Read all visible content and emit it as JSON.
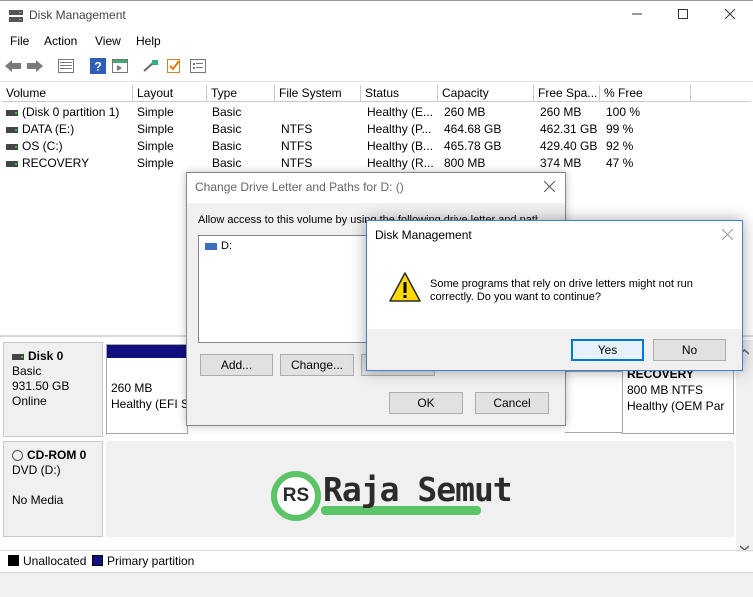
{
  "window": {
    "title": "Disk Management"
  },
  "icons": {
    "app": "disk-management-icon",
    "minimize": "minimize-icon",
    "maximize": "maximize-icon",
    "close": "close-icon",
    "warning": "warning-icon"
  },
  "menu": [
    "File",
    "Action",
    "View",
    "Help"
  ],
  "toolbar": [
    "back-icon",
    "forward-icon",
    "details-view-icon",
    "help-icon",
    "console-view-icon",
    "connect-icon",
    "checklist-icon",
    "properties-icon"
  ],
  "volume_table": {
    "columns": [
      "Volume",
      "Layout",
      "Type",
      "File System",
      "Status",
      "Capacity",
      "Free Spa...",
      "% Free"
    ],
    "rows": [
      [
        "(Disk 0 partition 1)",
        "Simple",
        "Basic",
        "",
        "Healthy (E...",
        "260 MB",
        "260 MB",
        "100 %"
      ],
      [
        "DATA (E:)",
        "Simple",
        "Basic",
        "NTFS",
        "Healthy (P...",
        "464.68 GB",
        "462.31 GB",
        "99 %"
      ],
      [
        "OS (C:)",
        "Simple",
        "Basic",
        "NTFS",
        "Healthy (B...",
        "465.78 GB",
        "429.40 GB",
        "92 %"
      ],
      [
        "RECOVERY",
        "Simple",
        "Basic",
        "NTFS",
        "Healthy (R...",
        "800 MB",
        "374 MB",
        "47 %"
      ]
    ]
  },
  "disks": [
    {
      "name": "Disk 0",
      "type": "Basic",
      "size": "931.50 GB",
      "state": "Online",
      "partitions": [
        {
          "size": "260 MB",
          "status": "Healthy (EFI S"
        },
        {
          "name": "RECOVERY",
          "size": "800 MB NTFS",
          "status": "Healthy (OEM Par"
        }
      ]
    },
    {
      "name": "CD-ROM 0",
      "type": "DVD (D:)",
      "state": "No Media"
    }
  ],
  "legend": [
    {
      "label": "Unallocated",
      "color": "#000000"
    },
    {
      "label": "Primary partition",
      "color": "#101080"
    }
  ],
  "logo": {
    "initials": "RS",
    "text": "Raja Semut"
  },
  "dialog_paths": {
    "title": "Change Drive Letter and Paths for D: ()",
    "instruction": "Allow access to this volume by using the following drive letter and paths:",
    "list_item": "D:",
    "add": "Add...",
    "change": "Change...",
    "ok": "OK",
    "cancel": "Cancel"
  },
  "dialog_confirm": {
    "title": "Disk Management",
    "line1": "Some programs that rely on drive letters might not run",
    "line2": "correctly. Do you want to continue?",
    "yes": "Yes",
    "no": "No"
  },
  "colors": {
    "primary_partition": "#101080",
    "logo_green": "#5bc466",
    "focus_blue": "#0078d7"
  }
}
